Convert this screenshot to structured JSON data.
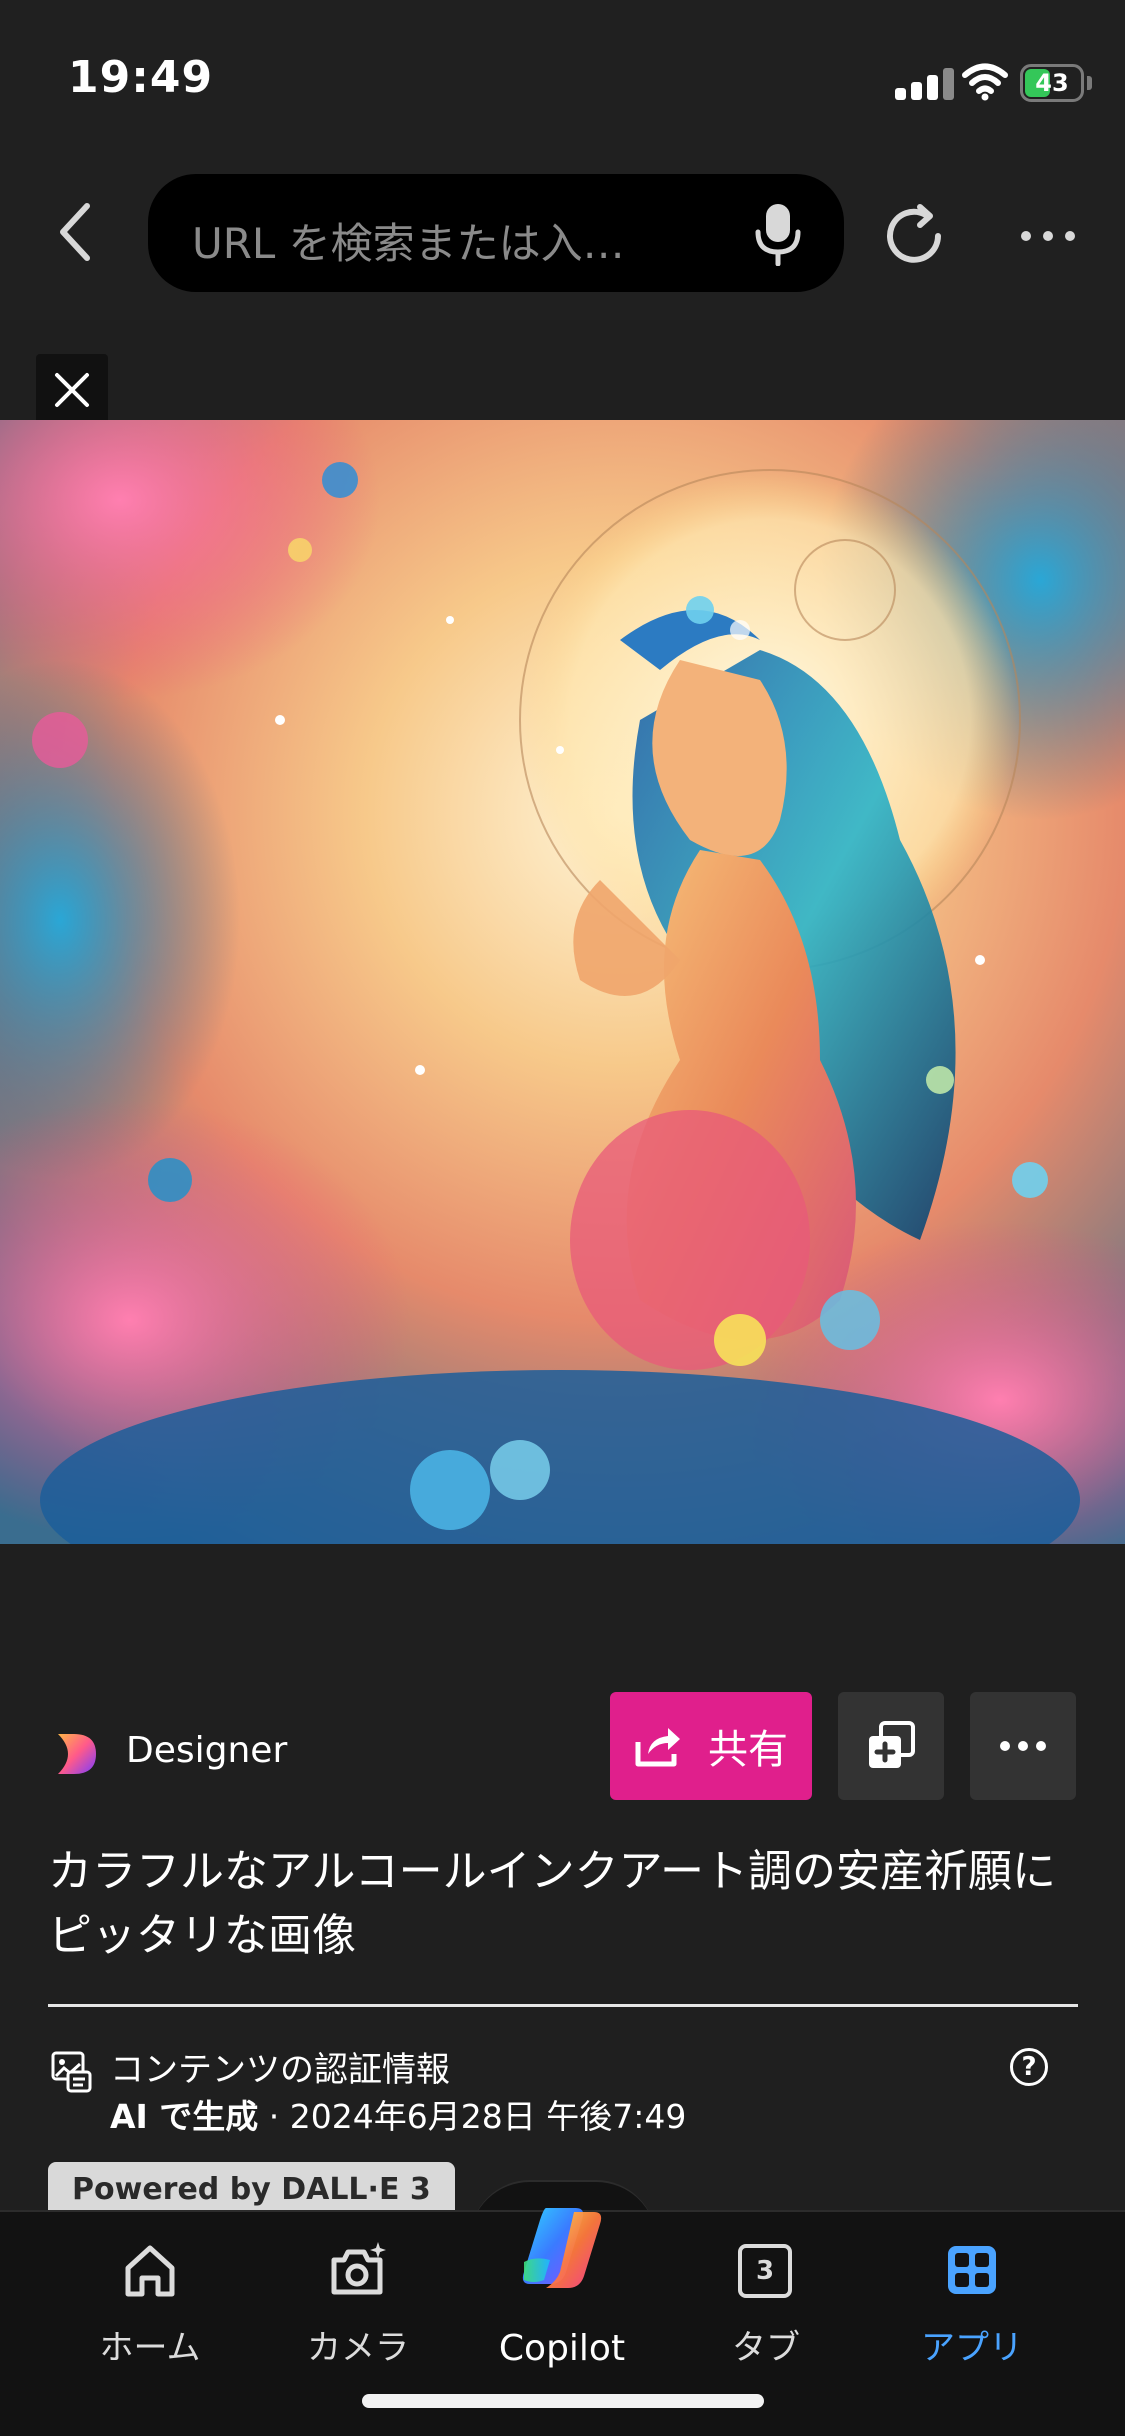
{
  "status_bar": {
    "time": "19:49",
    "battery": "43",
    "battery_level_fraction": 0.43,
    "icons": [
      "signal-icon",
      "wifi-icon",
      "battery-charging-icon"
    ]
  },
  "toolbar": {
    "search_placeholder": "URL を検索または入…",
    "icons": [
      "back-icon",
      "microphone-icon",
      "reload-icon",
      "more-icon"
    ]
  },
  "viewer": {
    "designer_label": "Designer",
    "share_label": "共有",
    "caption": "カラフルなアルコールインクアート調の安産祈願にピッタリな画像",
    "credentials": {
      "title": "コンテンツの認証情報",
      "ai_label": "AI で生成",
      "separator": " · ",
      "date": "2024年6月28日 午後7:49",
      "help": "?"
    },
    "powered_by": "Powered by DALL·E 3"
  },
  "tabbar": {
    "items": [
      {
        "label": "ホーム",
        "icon": "home-icon"
      },
      {
        "label": "カメラ",
        "icon": "camera-sparkle-icon"
      },
      {
        "label": "Copilot",
        "icon": "copilot-icon"
      },
      {
        "label": "タブ",
        "icon": "tabs-icon",
        "count": "3"
      },
      {
        "label": "アプリ",
        "icon": "apps-grid-icon",
        "active": true
      }
    ]
  },
  "colors": {
    "background": "#1f1f1f",
    "share_button": "#e01f8c",
    "active_tab": "#4aa3ff",
    "battery": "#34c759"
  }
}
